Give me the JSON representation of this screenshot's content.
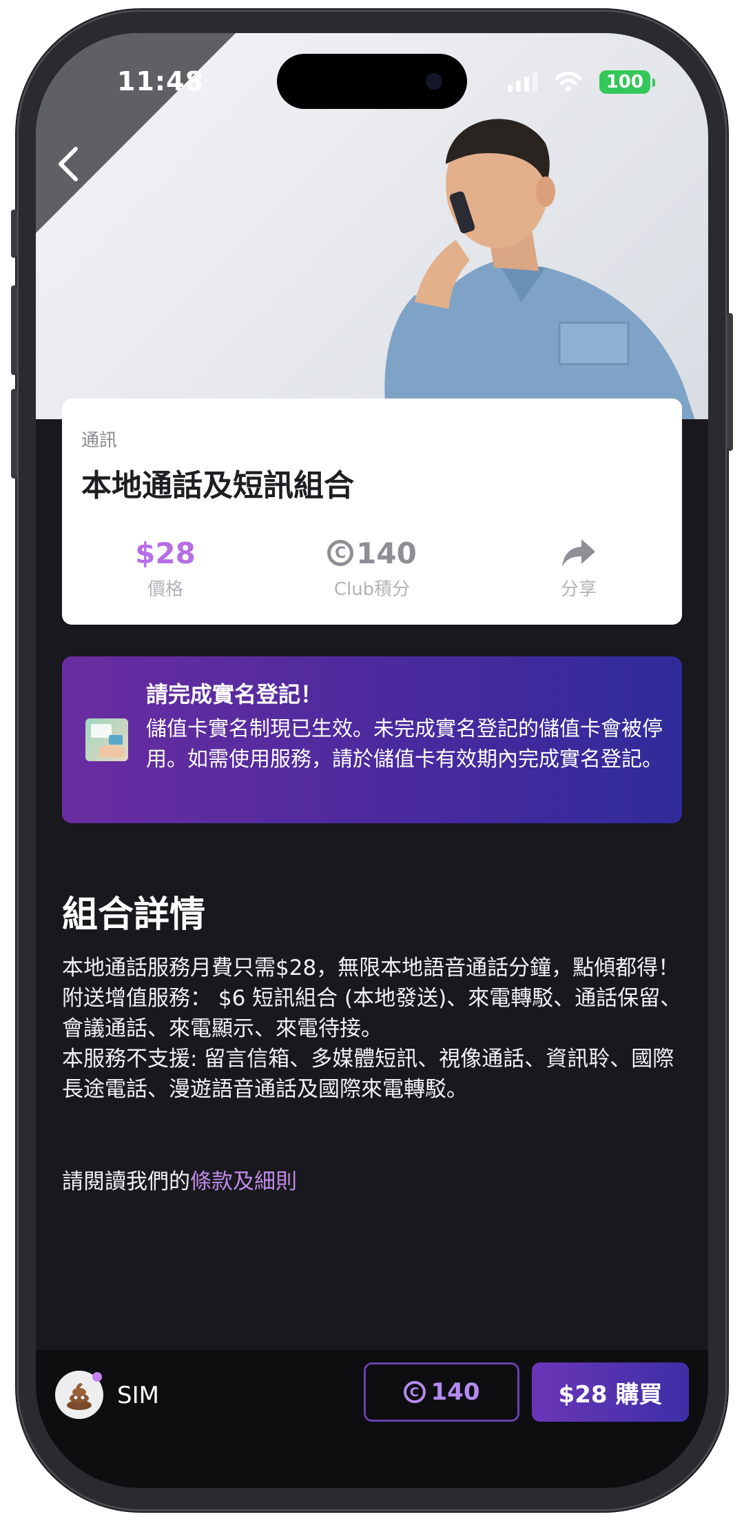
{
  "status_bar": {
    "time": "11:48",
    "battery": "100"
  },
  "product": {
    "category": "通訊",
    "title": "本地通話及短訊組合",
    "price_value": "$28",
    "price_label": "價格",
    "club_points_value": "140",
    "club_points_label": "Club積分",
    "share_label": "分享"
  },
  "notice": {
    "title": "請完成實名登記！",
    "body": "儲值卡實名制現已生效。未完成實名登記的儲值卡會被停用。如需使用服務，請於儲值卡有效期內完成實名登記。"
  },
  "details": {
    "heading": "組合詳情",
    "lines": [
      "本地通話服務月費只需$28，無限本地語音通話分鐘，點傾都得！",
      "附送增值服務：  $6 短訊組合 (本地發送)、來電轉駁、通話保留、會議通話、來電顯示、來電待接。",
      "本服務不支援: 留言信箱、多媒體短訊、視像通話、資訊聆、國際長途電話、漫遊語音通話及國際來電轉駁。"
    ],
    "terms_prefix": "請閱讀我們的",
    "terms_link": "條款及細則"
  },
  "bottom_bar": {
    "sim_label": "SIM",
    "club_points": "140",
    "buy_label": "$28 購買"
  },
  "icons": {
    "back": "chevron-left-icon",
    "club": "club-points-icon",
    "share": "share-arrow-icon",
    "avatar": "poop-emoji-icon"
  },
  "colors": {
    "accent": "#b66ee6",
    "background": "#18181d",
    "banner_start": "#6a2da0",
    "banner_end": "#302b9a",
    "buy_button": "#5a33b2"
  }
}
